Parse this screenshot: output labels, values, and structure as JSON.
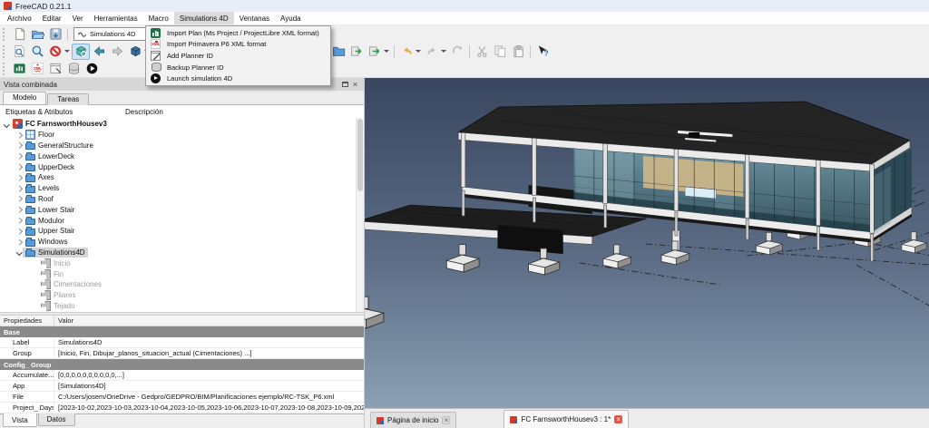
{
  "window": {
    "title": "FreeCAD 0.21.1",
    "icon": "freecad-logo"
  },
  "menubar": {
    "items": [
      {
        "label": "Archivo",
        "cls": ""
      },
      {
        "label": "Editar",
        "cls": ""
      },
      {
        "label": "Ver",
        "cls": ""
      },
      {
        "label": "Herramientas",
        "cls": ""
      },
      {
        "label": "Macro",
        "cls": ""
      },
      {
        "label": "Simulations 4D",
        "cls": "open"
      },
      {
        "label": "Ventanas",
        "cls": ""
      },
      {
        "label": "Ayuda",
        "cls": ""
      }
    ]
  },
  "toolbar": {
    "workbench_selector": {
      "value": "Simulations 4D",
      "icon": "spline-icon"
    },
    "file_row_icons": [
      "new-file",
      "open-folder",
      "save"
    ],
    "view_row_icons": [
      "link-select",
      "zoom",
      "clipping-no-sign-dropdown",
      "fit-all-active",
      "nav-back",
      "nav-forward",
      "axonometric-dropdown",
      "open-folder-2",
      "export",
      "export-dropdown",
      "undo-dropdown",
      "redo-dropdown",
      "refresh",
      "cut",
      "copy",
      "paste",
      "whats-this"
    ],
    "simulation_row_icons": [
      "import-ms-project",
      "import-primavera-xml",
      "add-planner-id",
      "backup-planner-id",
      "launch-simulation-4d"
    ]
  },
  "dropdown_menu": {
    "items": [
      {
        "label": "Import Plan (Ms Project / ProjectLibre XML format)",
        "icon": "ms-project-icon"
      },
      {
        "label": "Import Primavera P6 XML format",
        "icon": "xml-icon"
      },
      {
        "label": "Add Planner ID",
        "icon": "add-icon"
      },
      {
        "label": "Backup Planner ID",
        "icon": "db-icon"
      },
      {
        "label": "Launch simulation 4D",
        "icon": "play-icon"
      }
    ]
  },
  "combo_view": {
    "title": "Vista combinada",
    "tabs": [
      {
        "label": "Modelo",
        "cls": "active"
      },
      {
        "label": "Tareas",
        "cls": ""
      }
    ],
    "tree": {
      "columns": [
        "Etiquetas & Atributos",
        "Descripción"
      ],
      "items": [
        {
          "label": "FC FarnsworthHousev3",
          "icon": "freecad-doc-icon",
          "cls": "lvl0 exp bold"
        },
        {
          "label": "Floor",
          "icon": "floor-icon",
          "cls": "lvl1 col"
        },
        {
          "label": "GeneralStructure",
          "icon": "folder-icon",
          "cls": "lvl1 col"
        },
        {
          "label": "LowerDeck",
          "icon": "folder-icon",
          "cls": "lvl1 col"
        },
        {
          "label": "UpperDeck",
          "icon": "folder-icon",
          "cls": "lvl1 col"
        },
        {
          "label": "Axes",
          "icon": "folder-icon",
          "cls": "lvl1 col"
        },
        {
          "label": "Levels",
          "icon": "folder-icon",
          "cls": "lvl1 col"
        },
        {
          "label": "Roof",
          "icon": "folder-icon",
          "cls": "lvl1 col"
        },
        {
          "label": "Lower Stair",
          "icon": "folder-icon",
          "cls": "lvl1 col"
        },
        {
          "label": "Modulor",
          "icon": "folder-icon",
          "cls": "lvl1 col"
        },
        {
          "label": "Upper Stair",
          "icon": "folder-icon",
          "cls": "lvl1 col"
        },
        {
          "label": "Windows",
          "icon": "folder-icon",
          "cls": "lvl1 col"
        },
        {
          "label": "Simulations4D",
          "icon": "folder-icon",
          "cls": "lvl1 exp sel"
        },
        {
          "label": "Inicio",
          "icon": "task-icon",
          "cls": "lvl2 none gray"
        },
        {
          "label": "Fin",
          "icon": "task-icon",
          "cls": "lvl2 none gray"
        },
        {
          "label": "Cimentaciones",
          "icon": "task-icon",
          "cls": "lvl2 none gray"
        },
        {
          "label": "Pilares",
          "icon": "task-icon",
          "cls": "lvl2 none gray"
        },
        {
          "label": "Tejado",
          "icon": "task-icon",
          "cls": "lvl2 none gray"
        }
      ]
    },
    "properties": {
      "columns": [
        "Propiedades",
        "Valor"
      ],
      "rows": [
        {
          "cls": "group",
          "label": "Base",
          "value": ""
        },
        {
          "cls": "prop",
          "label": "Label",
          "value": "Simulations4D"
        },
        {
          "cls": "prop",
          "label": "Group",
          "value": "[Inicio, Fin, Dibujar_planos_situacion_actual (Cimentaciones) ...]"
        },
        {
          "cls": "group",
          "label": "Config_ Group",
          "value": ""
        },
        {
          "cls": "prop",
          "label": "Accumulate...",
          "value": "[0,0,0,0,0,0,0,0,0,0,...]"
        },
        {
          "cls": "prop",
          "label": "App",
          "value": "[Simulations4D]"
        },
        {
          "cls": "prop",
          "label": "File",
          "value": "C:/Users/josem/OneDrive - Gedpro/GEDPRO/BIM/Planificaciones ejemplo/RC-TSK_P6.xml"
        },
        {
          "cls": "prop",
          "label": "Project_ Days",
          "value": "[2023-10-02,2023-10-03,2023-10-04,2023-10-05,2023-10-06,2023-10-07,2023-10-08,2023-10-09,202..."
        }
      ]
    },
    "bottom_tabs": [
      {
        "label": "Vista",
        "cls": "active"
      },
      {
        "label": "Datos",
        "cls": ""
      }
    ]
  },
  "viewport": {
    "model_name": "FC FarnsworthHousev3 3D model",
    "colors": {
      "sky_top": "#39465f",
      "sky_bottom": "#8ca0b5",
      "slab_dark": "#242424",
      "fascia_white": "#ebebeb",
      "glass_teal": "#6e95a3",
      "glass_dark": "#2b4854",
      "panel_tan": "#c9b488"
    },
    "tabs": [
      {
        "label": "Página de inicio",
        "cls": "",
        "close": "gray"
      },
      {
        "label": "FC FarnsworthHousev3 : 1*",
        "cls": "active gap",
        "close": "red"
      }
    ]
  }
}
